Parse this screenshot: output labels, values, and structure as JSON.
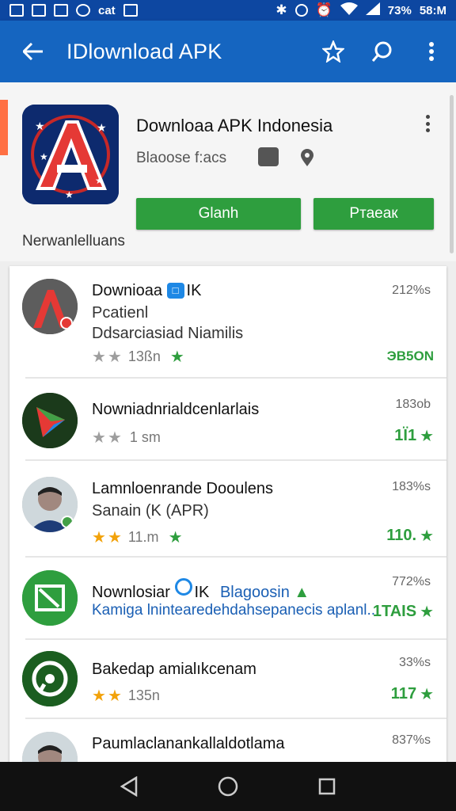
{
  "status_bar": {
    "left_icons": [
      "image-icon",
      "mail-icon",
      "photo-icon",
      "sync-icon",
      "cat-icon",
      "close-box-icon"
    ],
    "left_text": "cat",
    "right_icons": [
      "bluetooth-icon",
      "vibrate-icon",
      "alarm-icon",
      "wifi-icon",
      "signal-icon"
    ],
    "battery": "73%",
    "time": "58:M"
  },
  "app_bar": {
    "title": "IDlownload APK",
    "actions": [
      "star-icon",
      "search-icon",
      "more-vert-icon"
    ]
  },
  "header": {
    "app_name": "Downloaa APK Indonesia",
    "subtitle": "Blaoose f:acs",
    "primary_button": "Glanh",
    "secondary_button": "Ртаеак",
    "note": "Nerwanlelluans",
    "accent_color": "#2e9e3e"
  },
  "list": {
    "items": [
      {
        "title": "Downioaa",
        "badge": "IK",
        "line2": "Pcatienl",
        "line3": "Ddsarciasiad Niamilis",
        "meta": "13ßn",
        "right_top": "212%s",
        "right_bottom": "ЭВ5ОN"
      },
      {
        "title": "Nowniadnrialdcenlarlais",
        "meta": "1 sm",
        "right_top": "183ob",
        "right_bottom": "1Ї1"
      },
      {
        "title": "Lamnloenrande Dooulens",
        "line2": "Sanain (K (APR)",
        "meta": "11.m",
        "right_top": "183%s",
        "right_bottom": "110."
      },
      {
        "title": "Nownlosiar",
        "badge": "IK",
        "title_extra": "Blagoosin",
        "line2": "Kamiga lnintearedehdahsepanecis aplanl...",
        "right_top": "772%s",
        "right_bottom": "1TAIS"
      },
      {
        "title": "Bakedap amialıkcenam",
        "meta": "135n",
        "right_top": "33%s",
        "right_bottom": "117"
      },
      {
        "title": "Paumlaclanankallaldotlama",
        "right_top": "837%s"
      }
    ]
  }
}
